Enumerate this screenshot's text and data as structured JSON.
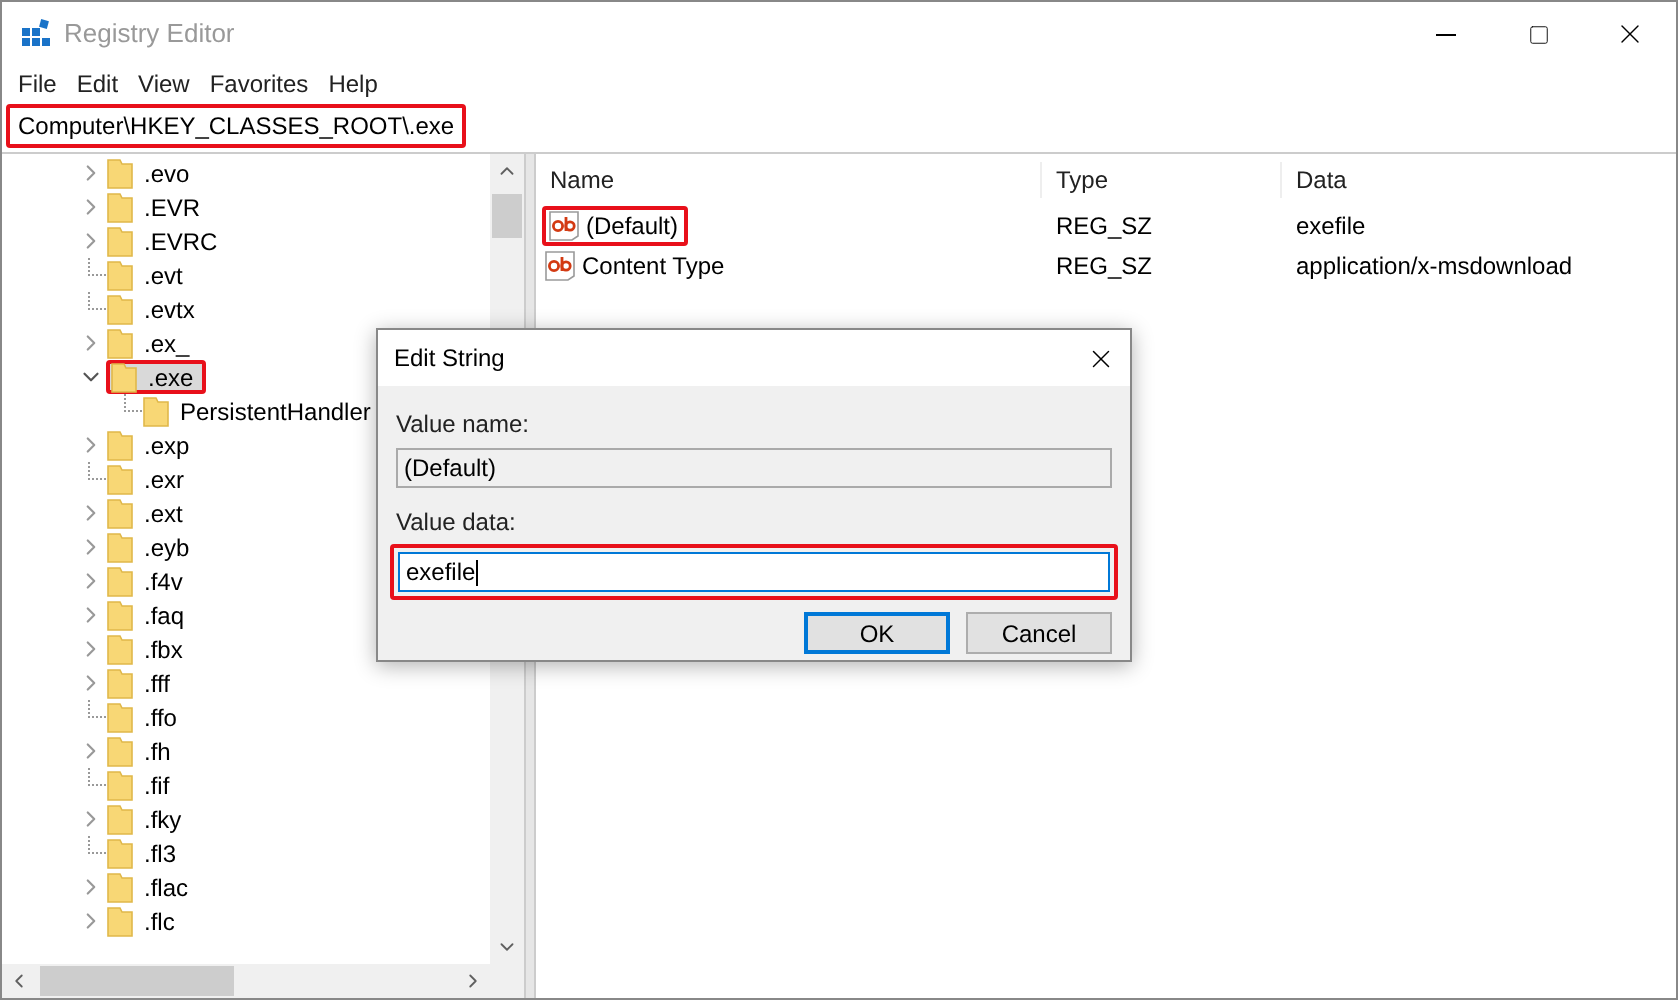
{
  "window": {
    "title": "Registry Editor"
  },
  "menu": [
    "File",
    "Edit",
    "View",
    "Favorites",
    "Help"
  ],
  "address": {
    "value": "Computer\\HKEY_CLASSES_ROOT\\.exe",
    "highlighted": true
  },
  "tree": [
    {
      "label": ".evo",
      "expandable": true,
      "expanded": false,
      "selected": false
    },
    {
      "label": ".EVR",
      "expandable": true,
      "expanded": false,
      "selected": false
    },
    {
      "label": ".EVRC",
      "expandable": true,
      "expanded": false,
      "selected": false
    },
    {
      "label": ".evt",
      "expandable": false,
      "selected": false
    },
    {
      "label": ".evtx",
      "expandable": false,
      "selected": false
    },
    {
      "label": ".ex_",
      "expandable": true,
      "expanded": false,
      "selected": false
    },
    {
      "label": ".exe",
      "expandable": true,
      "expanded": true,
      "selected": true,
      "children": [
        {
          "label": "PersistentHandler",
          "expandable": false,
          "selected": false
        }
      ]
    },
    {
      "label": ".exp",
      "expandable": true,
      "expanded": false,
      "selected": false
    },
    {
      "label": ".exr",
      "expandable": false,
      "selected": false
    },
    {
      "label": ".ext",
      "expandable": true,
      "expanded": false,
      "selected": false
    },
    {
      "label": ".eyb",
      "expandable": true,
      "expanded": false,
      "selected": false
    },
    {
      "label": ".f4v",
      "expandable": true,
      "expanded": false,
      "selected": false
    },
    {
      "label": ".faq",
      "expandable": true,
      "expanded": false,
      "selected": false
    },
    {
      "label": ".fbx",
      "expandable": true,
      "expanded": false,
      "selected": false
    },
    {
      "label": ".fff",
      "expandable": true,
      "expanded": false,
      "selected": false
    },
    {
      "label": ".ffo",
      "expandable": false,
      "selected": false
    },
    {
      "label": ".fh",
      "expandable": true,
      "expanded": false,
      "selected": false
    },
    {
      "label": ".fif",
      "expandable": false,
      "selected": false
    },
    {
      "label": ".fky",
      "expandable": true,
      "expanded": false,
      "selected": false
    },
    {
      "label": ".fl3",
      "expandable": false,
      "selected": false
    },
    {
      "label": ".flac",
      "expandable": true,
      "expanded": false,
      "selected": false
    },
    {
      "label": ".flc",
      "expandable": true,
      "expanded": false,
      "selected": false
    }
  ],
  "values": {
    "columns": [
      "Name",
      "Type",
      "Data"
    ],
    "rows": [
      {
        "name": "(Default)",
        "type": "REG_SZ",
        "data": "exefile",
        "highlighted": true
      },
      {
        "name": "Content Type",
        "type": "REG_SZ",
        "data": "application/x-msdownload",
        "highlighted": false
      }
    ]
  },
  "dialog": {
    "title": "Edit String",
    "name_label": "Value name:",
    "name_value": "(Default)",
    "data_label": "Value data:",
    "data_value": "exefile",
    "data_highlighted": true,
    "buttons": [
      "OK",
      "Cancel"
    ]
  }
}
